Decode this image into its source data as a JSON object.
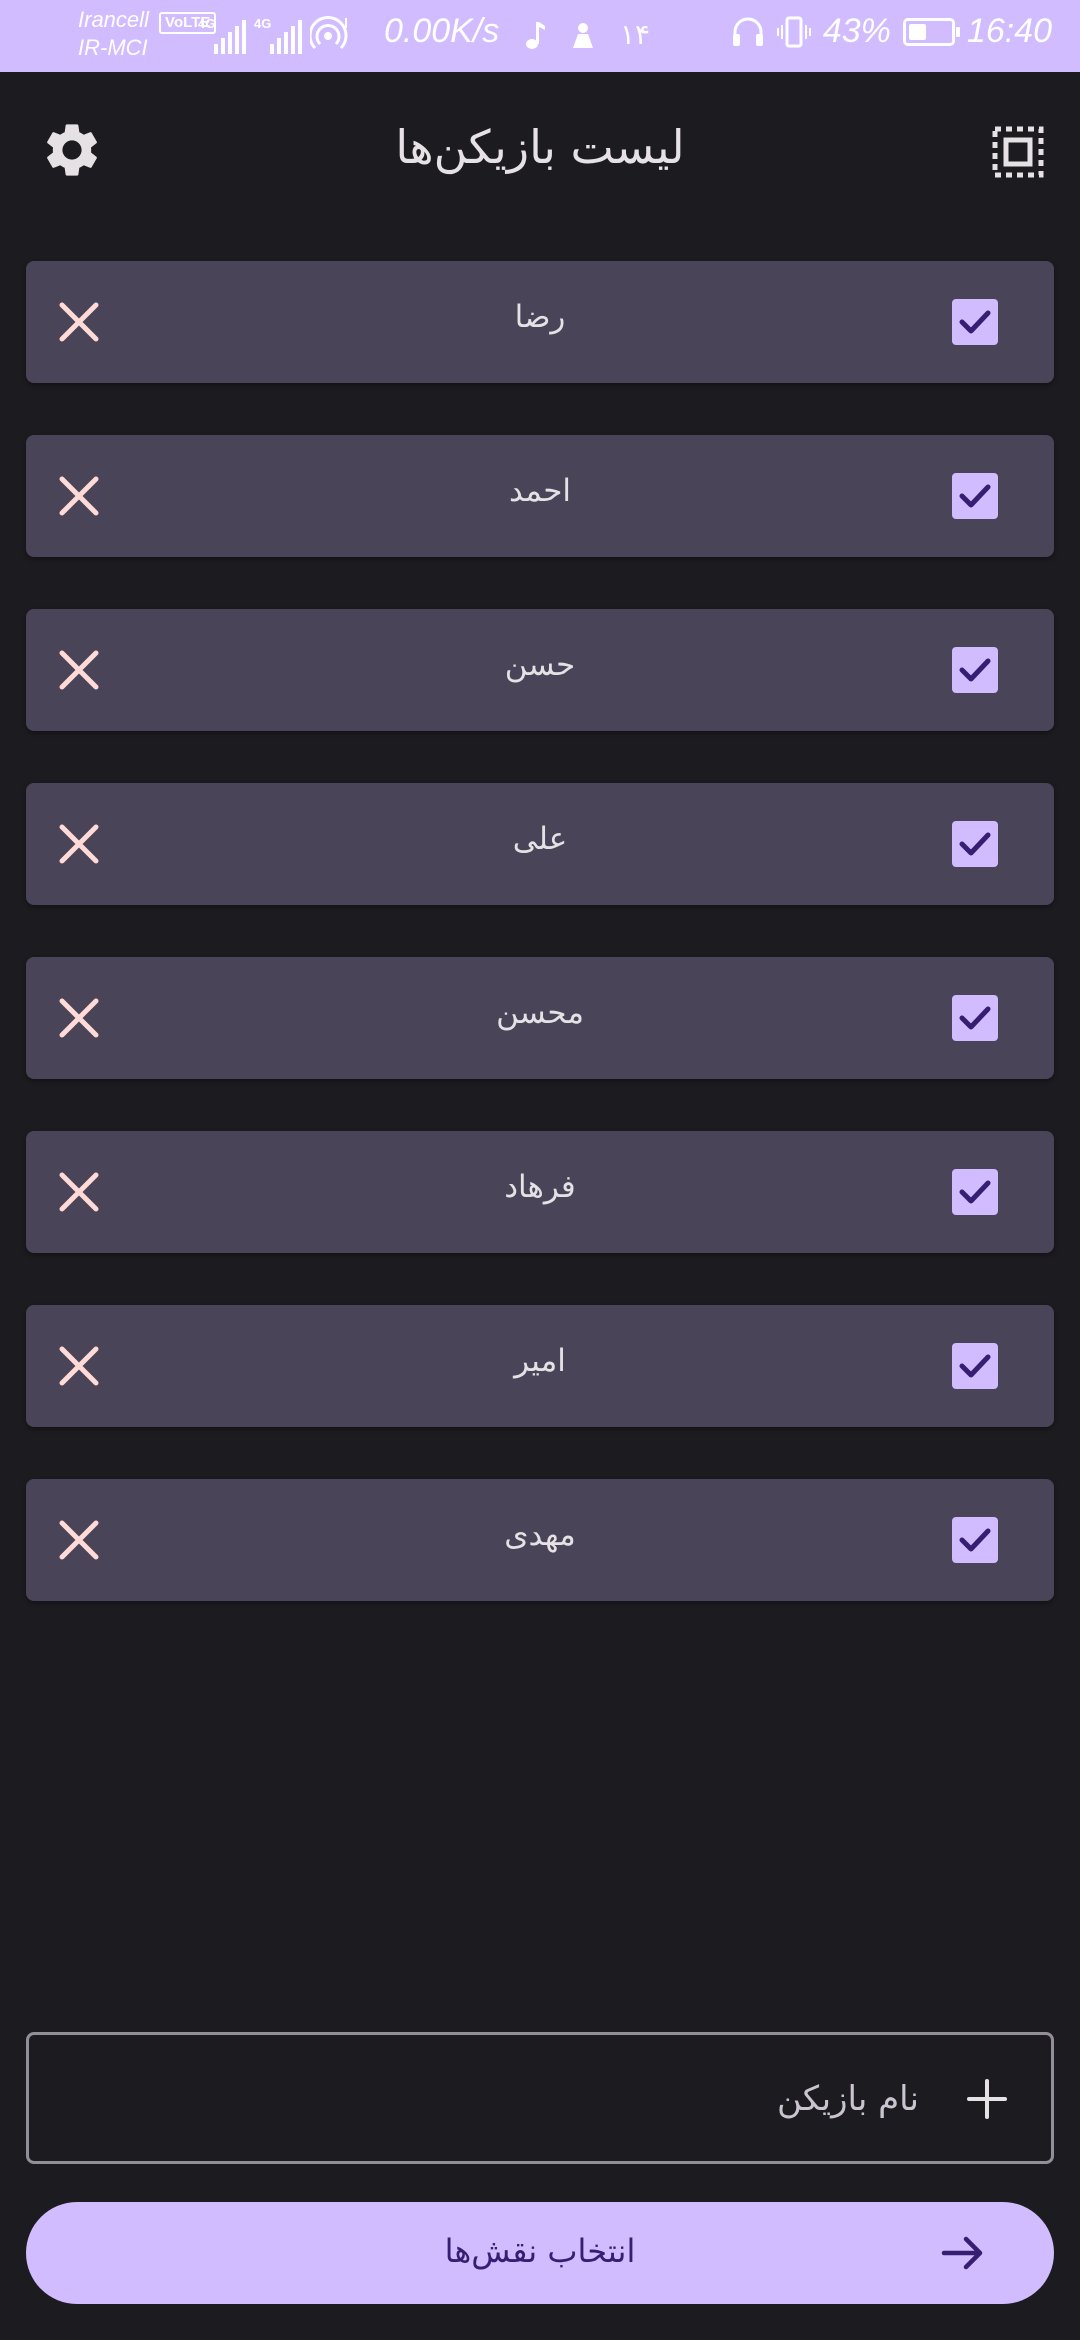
{
  "status_bar": {
    "carrier_1": "Irancell",
    "volte": "VoLTE",
    "carrier_2": "IR-MCI",
    "net_type_1": "4G",
    "net_type_2": "4G",
    "speed": "0.00K/s",
    "notification_count": "۱۴",
    "battery_percent": "43%",
    "battery_level": 0.43,
    "time": "16:40"
  },
  "header": {
    "title": "لیست بازیکن‌ها"
  },
  "players": [
    {
      "name": "رضا",
      "checked": true
    },
    {
      "name": "احمد",
      "checked": true
    },
    {
      "name": "حسن",
      "checked": true
    },
    {
      "name": "علی",
      "checked": true
    },
    {
      "name": "محسن",
      "checked": true
    },
    {
      "name": "فرهاد",
      "checked": true
    },
    {
      "name": "امیر",
      "checked": true
    },
    {
      "name": "مهدی",
      "checked": true
    }
  ],
  "add_player": {
    "placeholder": "نام بازیکن",
    "value": ""
  },
  "primary_action": {
    "label": "انتخاب نقش‌ها"
  },
  "colors": {
    "background": "#1c1b1f",
    "surface": "#4a4458",
    "accent": "#d0bcff",
    "on_accent": "#381e72",
    "remove_icon": "#ffdad6"
  },
  "icons": {
    "settings": "gear-icon",
    "select_all": "select-all-icon",
    "remove": "close-icon",
    "check": "checkbox-checked-icon",
    "add": "plus-icon",
    "next": "arrow-forward-icon"
  }
}
